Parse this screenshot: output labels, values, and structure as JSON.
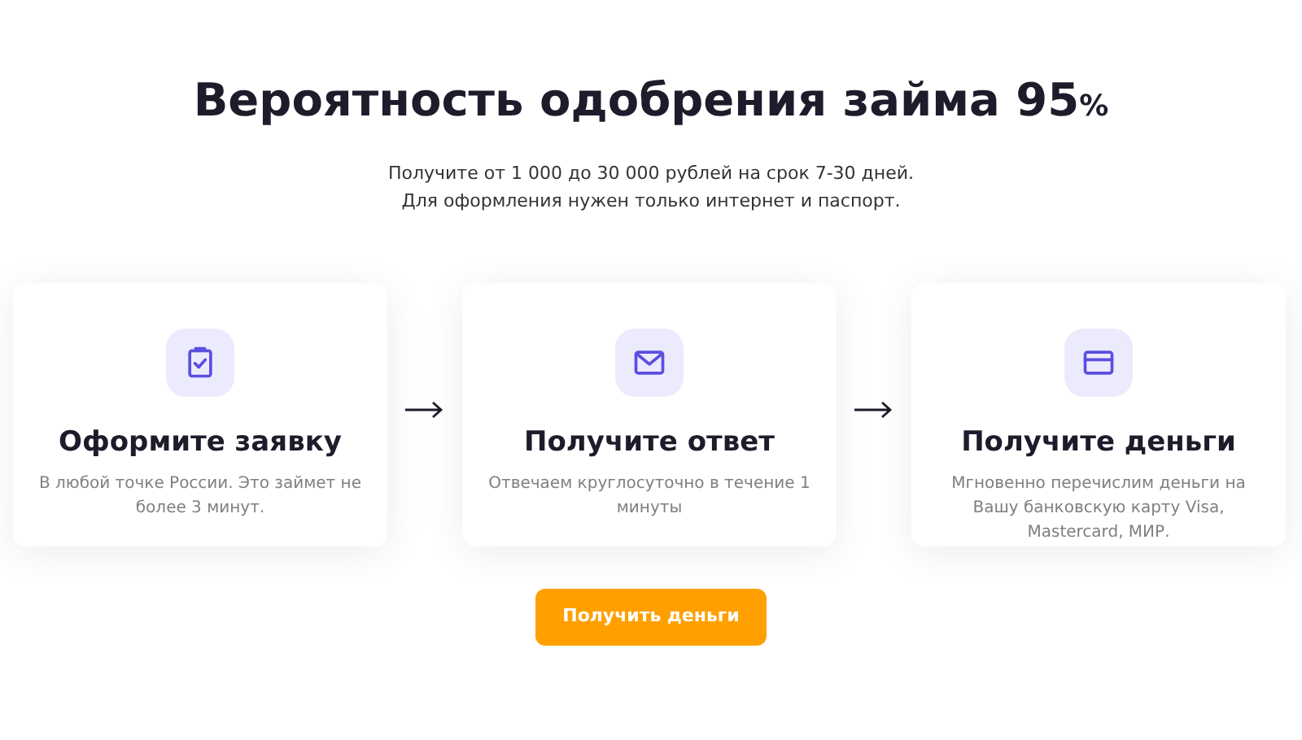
{
  "heading": {
    "title": "Вероятность одобрения займа 95",
    "suffix": "%"
  },
  "subtitle": [
    "Получите от 1 000 до 30 000 рублей на срок 7-30 дней.",
    "Для оформления нужен только интернет и паспорт."
  ],
  "steps": [
    {
      "title": "Оформите заявку",
      "text": "В любой точке России. Это займет не более 3 минут."
    },
    {
      "title": "Получите ответ",
      "text": "Отвечаем круглосуточно в течение 1 минуты"
    },
    {
      "title": "Получите деньги",
      "text": "Мгновенно перечислим деньги на Вашу банковскую карту Visa, Mastercard, МИР."
    }
  ],
  "button": "Получить деньги"
}
